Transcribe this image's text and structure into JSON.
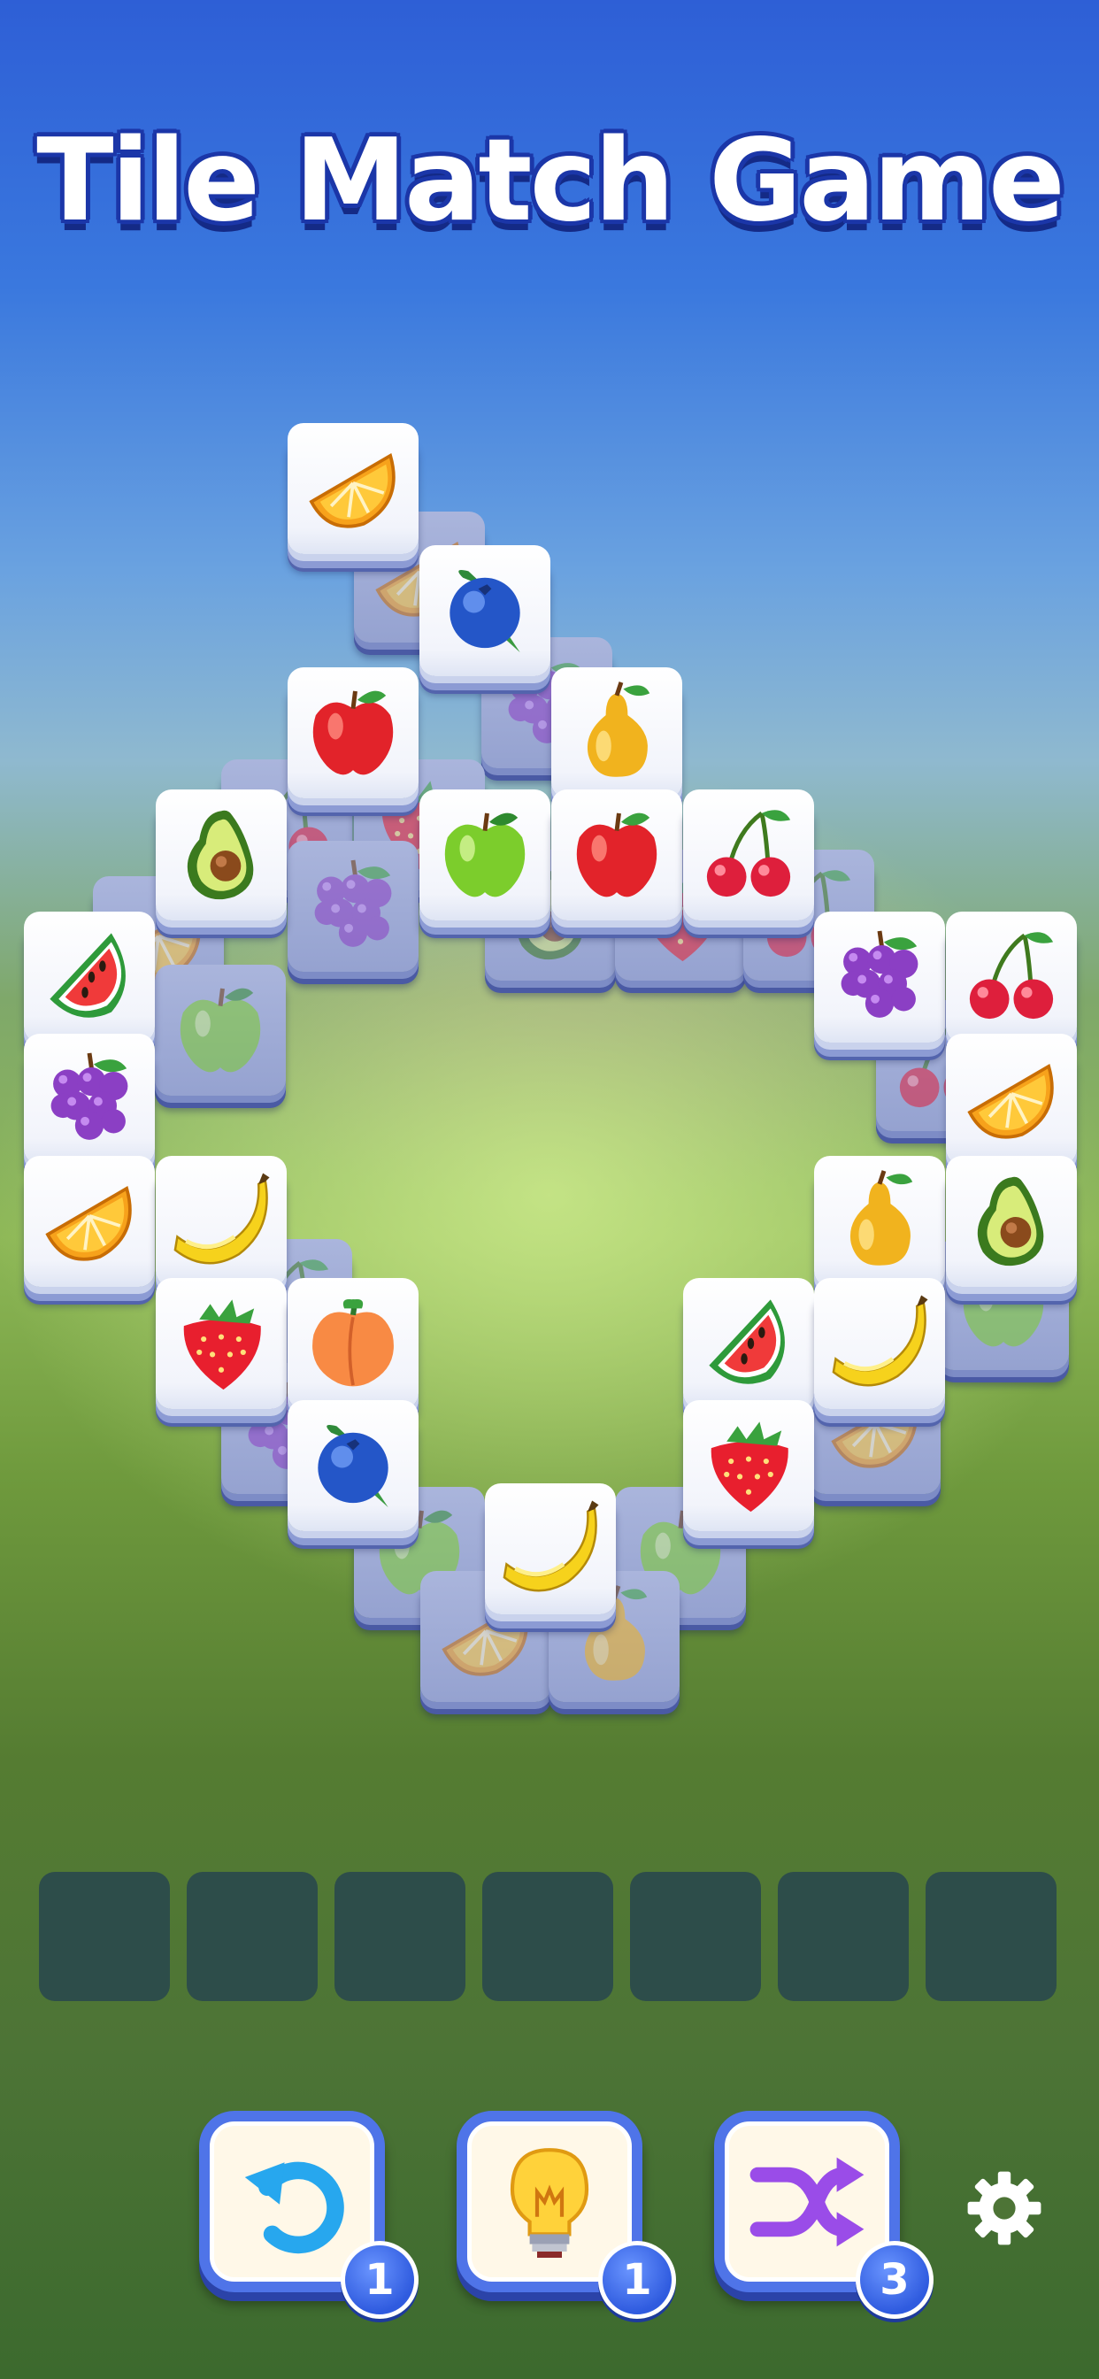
{
  "title": "Tile Match Game",
  "board": {
    "tiles_top": [
      {
        "fruit": "orange"
      },
      {
        "fruit": "blueberry"
      },
      {
        "fruit": "apple-red"
      },
      {
        "fruit": "pear"
      },
      {
        "fruit": "avocado"
      },
      {
        "fruit": "apple-green"
      },
      {
        "fruit": "apple-red"
      },
      {
        "fruit": "cherry"
      },
      {
        "fruit": "watermelon"
      },
      {
        "fruit": "grapes"
      },
      {
        "fruit": "cherry"
      },
      {
        "fruit": "grapes"
      },
      {
        "fruit": "orange"
      },
      {
        "fruit": "orange"
      },
      {
        "fruit": "banana"
      },
      {
        "fruit": "pear"
      },
      {
        "fruit": "avocado"
      },
      {
        "fruit": "strawberry"
      },
      {
        "fruit": "peach"
      },
      {
        "fruit": "watermelon"
      },
      {
        "fruit": "banana"
      },
      {
        "fruit": "blueberry"
      },
      {
        "fruit": "strawberry"
      },
      {
        "fruit": "banana"
      }
    ]
  },
  "tray": {
    "slot_count": 7
  },
  "tools": [
    {
      "name": "undo",
      "icon": "undo-arrow-icon",
      "count": "1"
    },
    {
      "name": "hint",
      "icon": "lightbulb-icon",
      "count": "1"
    },
    {
      "name": "shuffle",
      "icon": "shuffle-icon",
      "count": "3"
    }
  ],
  "settings": {
    "icon": "gear-icon"
  },
  "colors": {
    "title_outline": "#1b36a8",
    "tool_border": "#4f74e8",
    "badge": "#2f5bdf",
    "slot": "#2a4a4c"
  }
}
